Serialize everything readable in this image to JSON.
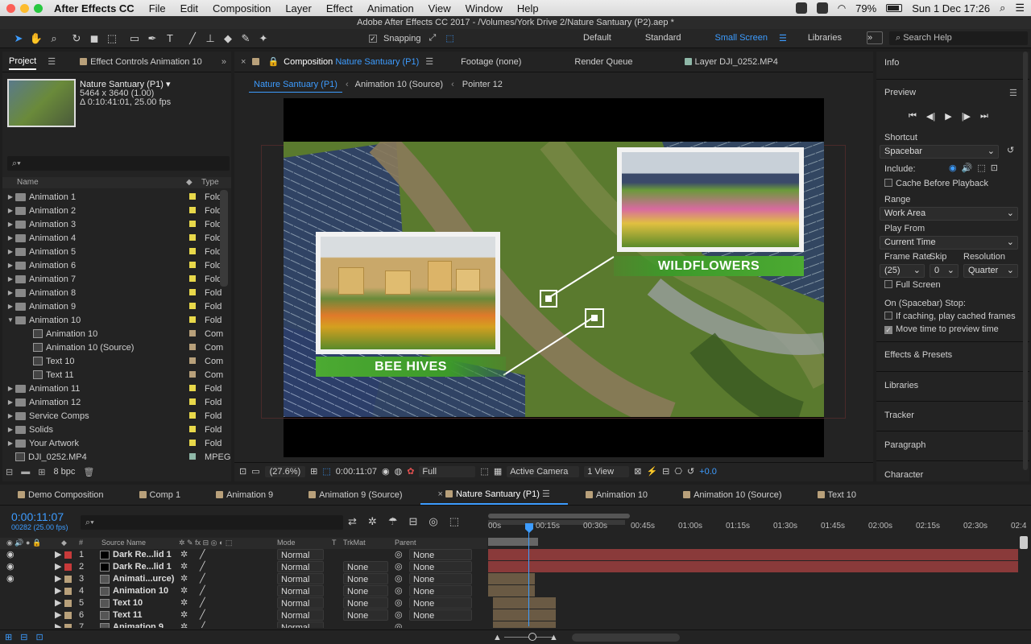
{
  "menubar": {
    "app_name": "After Effects CC",
    "items": [
      "File",
      "Edit",
      "Composition",
      "Layer",
      "Effect",
      "Animation",
      "View",
      "Window",
      "Help"
    ],
    "battery": "79%",
    "datetime": "Sun 1 Dec  17:26"
  },
  "window_title": "Adobe After Effects CC 2017 - /Volumes/York Drive 2/Nature Santuary (P2).aep *",
  "toolbar": {
    "snapping_label": "Snapping",
    "workspaces": [
      "Default",
      "Standard",
      "Small Screen",
      "Libraries"
    ],
    "active_workspace": "Small Screen",
    "search_placeholder": "Search Help"
  },
  "project": {
    "tab_project": "Project",
    "tab_effect_controls": "Effect Controls Animation 10",
    "item_name": "Nature Santuary (P1) ▾",
    "item_size": "5464 x 3640 (1.00)",
    "item_duration": "Δ 0:10:41:01, 25.00 fps",
    "search_placeholder": "",
    "col_name": "Name",
    "col_type": "Type",
    "rows": [
      {
        "name": "Animation 1",
        "type": "Fold",
        "kind": "folder",
        "indent": 0,
        "open": false
      },
      {
        "name": "Animation 2",
        "type": "Fold",
        "kind": "folder",
        "indent": 0,
        "open": false
      },
      {
        "name": "Animation 3",
        "type": "Fold",
        "kind": "folder",
        "indent": 0,
        "open": false
      },
      {
        "name": "Animation 4",
        "type": "Fold",
        "kind": "folder",
        "indent": 0,
        "open": false
      },
      {
        "name": "Animation 5",
        "type": "Fold",
        "kind": "folder",
        "indent": 0,
        "open": false
      },
      {
        "name": "Animation 6",
        "type": "Fold",
        "kind": "folder",
        "indent": 0,
        "open": false
      },
      {
        "name": "Animation 7",
        "type": "Fold",
        "kind": "folder",
        "indent": 0,
        "open": false
      },
      {
        "name": "Animation 8",
        "type": "Fold",
        "kind": "folder",
        "indent": 0,
        "open": false
      },
      {
        "name": "Animation 9",
        "type": "Fold",
        "kind": "folder",
        "indent": 0,
        "open": false
      },
      {
        "name": "Animation 10",
        "type": "Fold",
        "kind": "folder",
        "indent": 0,
        "open": true
      },
      {
        "name": "Animation 10",
        "type": "Com",
        "kind": "comp",
        "indent": 1,
        "open": false
      },
      {
        "name": "Animation 10 (Source)",
        "type": "Com",
        "kind": "comp",
        "indent": 1,
        "open": false
      },
      {
        "name": "Text 10",
        "type": "Com",
        "kind": "comp",
        "indent": 1,
        "open": false
      },
      {
        "name": "Text 11",
        "type": "Com",
        "kind": "comp",
        "indent": 1,
        "open": false
      },
      {
        "name": "Animation 11",
        "type": "Fold",
        "kind": "folder",
        "indent": 0,
        "open": false
      },
      {
        "name": "Animation 12",
        "type": "Fold",
        "kind": "folder",
        "indent": 0,
        "open": false
      },
      {
        "name": "Service Comps",
        "type": "Fold",
        "kind": "folder",
        "indent": 0,
        "open": false
      },
      {
        "name": "Solids",
        "type": "Fold",
        "kind": "folder",
        "indent": 0,
        "open": false
      },
      {
        "name": "Your Artwork",
        "type": "Fold",
        "kind": "folder",
        "indent": 0,
        "open": false
      },
      {
        "name": "DJI_0252.MP4",
        "type": "MPEG",
        "kind": "file",
        "indent": 0,
        "open": false
      }
    ],
    "bpc": "8 bpc"
  },
  "comp": {
    "tabs": [
      {
        "label": "Composition",
        "sub": "Nature Santuary (P1)"
      },
      {
        "label": "Footage (none)"
      },
      {
        "label": "Render Queue"
      },
      {
        "label": "Layer DJI_0252.MP4"
      }
    ],
    "breadcrumbs": [
      "Nature Santuary (P1)",
      "Animation 10 (Source)",
      "Pointer 12"
    ],
    "callout_left": "BEE HIVES",
    "callout_right": "WILDFLOWERS",
    "footer": {
      "zoom": "(27.6%)",
      "timecode": "0:00:11:07",
      "resolution": "Full",
      "camera": "Active Camera",
      "view": "1 View",
      "exposure": "+0.0"
    }
  },
  "right_panel": {
    "info": "Info",
    "preview": "Preview",
    "shortcut_label": "Shortcut",
    "shortcut_value": "Spacebar",
    "include_label": "Include:",
    "cache_before": "Cache Before Playback",
    "range_label": "Range",
    "range_value": "Work Area",
    "play_from_label": "Play From",
    "play_from_value": "Current Time",
    "frame_rate_label": "Frame Rate",
    "skip_label": "Skip",
    "resolution_label": "Resolution",
    "frame_rate_value": "(25)",
    "skip_value": "0",
    "resolution_value": "Quarter",
    "full_screen": "Full Screen",
    "stop_label": "On (Spacebar) Stop:",
    "if_caching": "If caching, play cached frames",
    "move_time": "Move time to preview time",
    "sections": [
      "Effects & Presets",
      "Libraries",
      "Tracker",
      "Paragraph",
      "Character"
    ]
  },
  "timeline": {
    "tabs": [
      "Demo Composition",
      "Comp 1",
      "Animation 9",
      "Animation 9 (Source)",
      "Nature Santuary (P1)",
      "Animation 10",
      "Animation 10 (Source)",
      "Text 10"
    ],
    "active_tab": "Nature Santuary (P1)",
    "timecode": "0:00:11:07",
    "frames": "00282 (25.00 fps)",
    "col_source": "Source Name",
    "col_mode": "Mode",
    "col_t": "T",
    "col_trkmat": "TrkMat",
    "col_parent": "Parent",
    "ruler": [
      "00s",
      "00:15s",
      "00:30s",
      "00:45s",
      "01:00s",
      "01:15s",
      "01:30s",
      "01:45s",
      "02:00s",
      "02:15s",
      "02:30s",
      "02:4"
    ],
    "layers": [
      {
        "num": "1",
        "name": "Dark Re...lid 1",
        "mode": "Normal",
        "trkmat": "",
        "parent": "None",
        "color": "#c73a3a",
        "visible": true
      },
      {
        "num": "2",
        "name": "Dark Re...lid 1",
        "mode": "Normal",
        "trkmat": "None",
        "parent": "None",
        "color": "#c73a3a",
        "visible": true
      },
      {
        "num": "3",
        "name": "Animati...urce)",
        "mode": "Normal",
        "trkmat": "None",
        "parent": "None",
        "color": "#b8a07a",
        "visible": true
      },
      {
        "num": "4",
        "name": "Animation 10",
        "mode": "Normal",
        "trkmat": "None",
        "parent": "None",
        "color": "#b8a07a",
        "visible": false
      },
      {
        "num": "5",
        "name": "Text 10",
        "mode": "Normal",
        "trkmat": "None",
        "parent": "None",
        "color": "#b8a07a",
        "visible": false
      },
      {
        "num": "6",
        "name": "Text 11",
        "mode": "Normal",
        "trkmat": "None",
        "parent": "None",
        "color": "#b8a07a",
        "visible": false
      },
      {
        "num": "7",
        "name": "Animation 9",
        "mode": "Normal",
        "trkmat": "",
        "parent": "",
        "color": "#b8a07a",
        "visible": false
      }
    ]
  }
}
